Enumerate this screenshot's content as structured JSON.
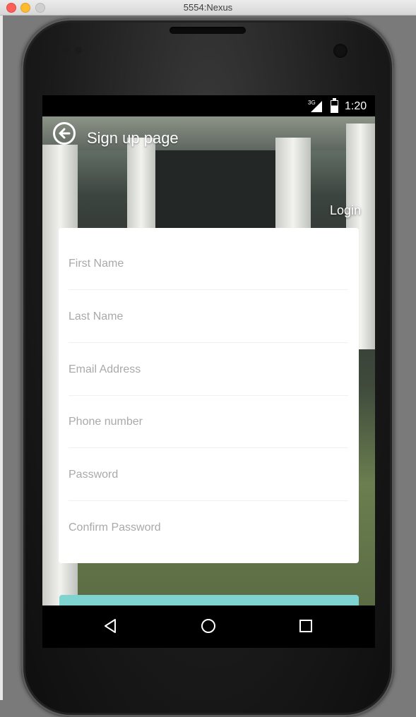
{
  "window": {
    "title": "5554:Nexus"
  },
  "statusbar": {
    "network": "3G",
    "time": "1:20"
  },
  "header": {
    "title": "Sign up page",
    "back_icon": "back-arrow-circle-icon"
  },
  "login_link": "Login",
  "form": {
    "fields": [
      {
        "placeholder": "First Name",
        "value": ""
      },
      {
        "placeholder": "Last Name",
        "value": ""
      },
      {
        "placeholder": "Email Address",
        "value": ""
      },
      {
        "placeholder": "Phone number",
        "value": ""
      },
      {
        "placeholder": "Password",
        "value": ""
      },
      {
        "placeholder": "Confirm Password",
        "value": ""
      }
    ]
  },
  "colors": {
    "submit_button": "#7fd4d1",
    "card": "#ffffff",
    "placeholder": "#a9a9a9"
  },
  "navbar": {
    "icons": [
      "back-triangle-icon",
      "home-circle-icon",
      "recents-square-icon"
    ]
  }
}
